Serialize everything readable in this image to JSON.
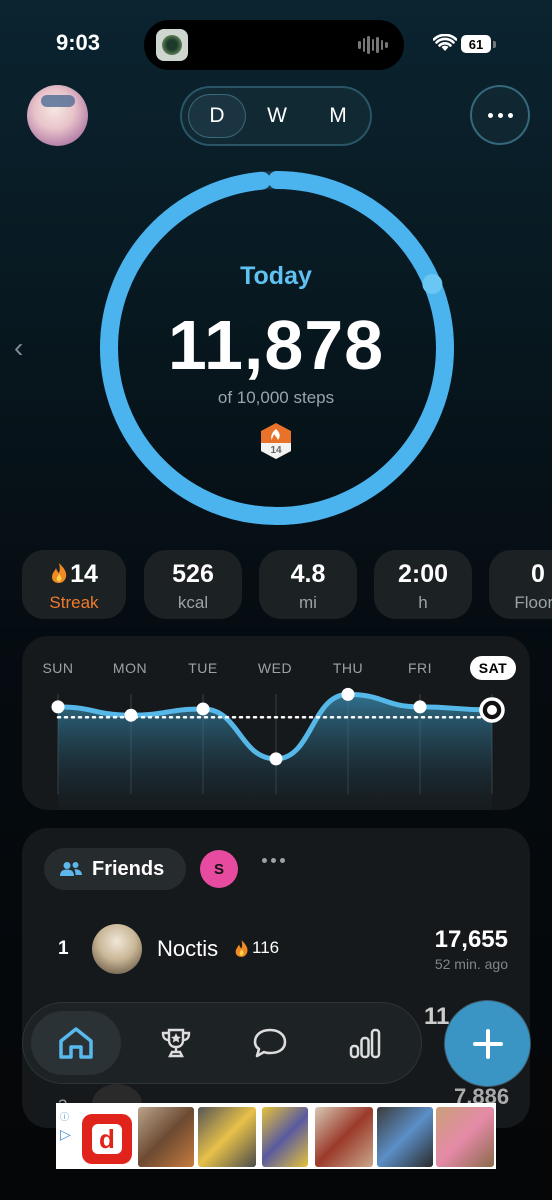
{
  "status": {
    "time": "9:03",
    "battery": "61"
  },
  "header": {
    "segments": [
      {
        "label": "D",
        "active": true
      },
      {
        "label": "W",
        "active": false
      },
      {
        "label": "M",
        "active": false
      }
    ],
    "menu_icon": "more-horizontal-icon"
  },
  "ring": {
    "label": "Today",
    "value": "11,878",
    "subtitle": "of 10,000 steps",
    "progress": 1.1878,
    "badge_value": "14",
    "color": "#4bb3ee"
  },
  "stats": [
    {
      "value": "14",
      "label": "Streak",
      "icon": "flame-icon"
    },
    {
      "value": "526",
      "label": "kcal"
    },
    {
      "value": "4.8",
      "label": "mi"
    },
    {
      "value": "2:00",
      "label": "h"
    },
    {
      "value": "0",
      "label": "Floors"
    }
  ],
  "week": {
    "days": [
      "SUN",
      "MON",
      "TUE",
      "WED",
      "THU",
      "FRI",
      "SAT"
    ],
    "selected": "SAT",
    "relative_values": [
      0.78,
      0.7,
      0.76,
      0.28,
      0.9,
      0.78,
      0.75
    ],
    "goal_relative": 0.68,
    "line_color": "#56b8e8"
  },
  "friends": {
    "label": "Friends",
    "avatar_initial": "S",
    "rows": [
      {
        "rank": "1",
        "name": "Noctis",
        "streak": "116",
        "steps": "17,655",
        "ago": "52 min. ago"
      }
    ],
    "peek": [
      {
        "steps": "11"
      },
      {
        "rank": "3",
        "steps": "7,886"
      }
    ]
  },
  "tabs": [
    {
      "name": "home",
      "icon": "home-icon",
      "active": true
    },
    {
      "name": "trophy",
      "icon": "trophy-icon",
      "active": false
    },
    {
      "name": "chat",
      "icon": "chat-bubble-icon",
      "active": false
    },
    {
      "name": "stats",
      "icon": "bar-chart-icon",
      "active": false
    }
  ],
  "fab_icon": "plus-icon",
  "ad": {
    "logo_letter": "d",
    "brand_color": "#e0241b"
  }
}
